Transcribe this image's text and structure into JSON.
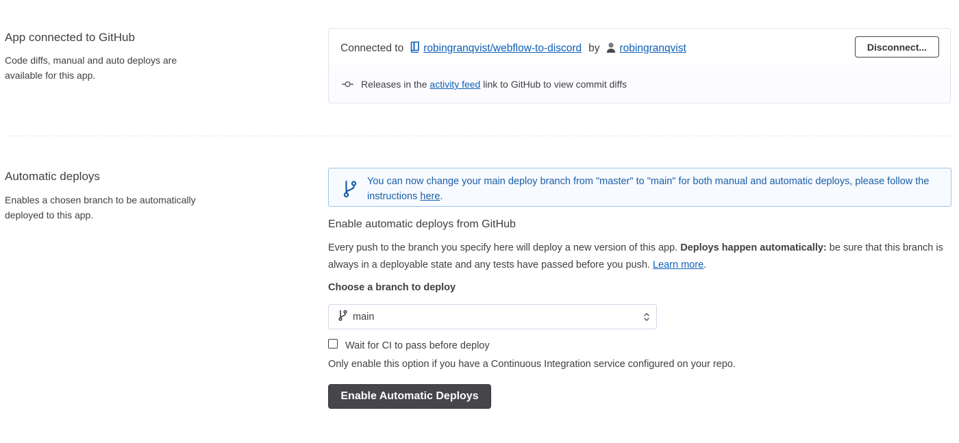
{
  "github_section": {
    "title": "App connected to GitHub",
    "description": "Code diffs, manual and auto deploys are available for this app.",
    "connected_label": "Connected to",
    "repo": "robingranqvist/webflow-to-discord",
    "by_label": "by",
    "user": "robingranqvist",
    "disconnect_label": "Disconnect...",
    "releases_pre": "Releases in the",
    "releases_link": "activity feed",
    "releases_post": "link to GitHub to view commit diffs"
  },
  "auto_deploy_section": {
    "title": "Automatic deploys",
    "description": "Enables a chosen branch to be automatically deployed to this app.",
    "info_text": "You can now change your main deploy branch from \"master\" to \"main\" for both manual and automatic deploys, please follow the instructions",
    "info_link": "here",
    "info_end": ".",
    "heading": "Enable automatic deploys from GitHub",
    "para_part1": "Every push to the branch you specify here will deploy a new version of this app.",
    "para_bold": "Deploys happen automatically:",
    "para_part2": "be sure that this branch is always in a deployable state and any tests have passed before you push.",
    "learn_more": "Learn more",
    "para_end": ".",
    "choose_label": "Choose a branch to deploy",
    "branch_value": "main",
    "ci_checkbox_label": "Wait for CI to pass before deploy",
    "ci_checked": false,
    "ci_hint": "Only enable this option if you have a Continuous Integration service configured on your repo.",
    "enable_button": "Enable Automatic Deploys"
  },
  "icons": {
    "repo": "repo-book-icon",
    "user": "user-avatar-icon",
    "commit": "git-commit-icon",
    "branch": "git-branch-icon",
    "select": "chevron-up-down-icon"
  },
  "colors": {
    "link": "#0d5fb8",
    "info_text": "#1a5fa8",
    "info_border": "#9fc3ea",
    "primary_button": "#45454a"
  }
}
